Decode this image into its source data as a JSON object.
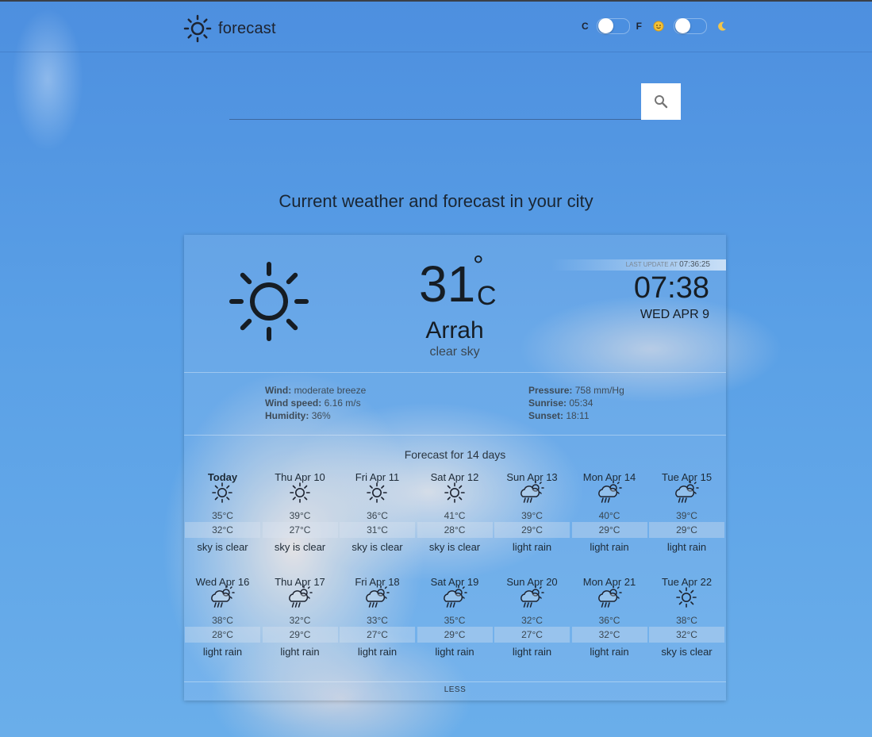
{
  "header": {
    "logo_text": "forecast",
    "unit_c": "C",
    "unit_f": "F",
    "icons": [
      "sun-logo-icon",
      "sun-face-icon",
      "moon-icon"
    ]
  },
  "search": {
    "placeholder": "",
    "icon": "search-icon"
  },
  "page_title": "Current weather and forecast in your city",
  "current": {
    "icon": "clear-sky-icon",
    "temp": "31",
    "degree_symbol": "°",
    "unit": "C",
    "city": "Arrah",
    "description": "clear sky",
    "last_update_label": "LAST UPDATE AT",
    "last_update_time": "07:36:25",
    "time": "07:38",
    "date": "WED APR 9"
  },
  "details": {
    "wind_label": "Wind:",
    "wind_value": "moderate breeze",
    "wind_speed_label": "Wind speed:",
    "wind_speed_value": "6.16 m/s",
    "humidity_label": "Humidity:",
    "humidity_value": "36%",
    "pressure_label": "Pressure:",
    "pressure_value": "758 mm/Hg",
    "sunrise_label": "Sunrise:",
    "sunrise_value": "05:34",
    "sunset_label": "Sunset:",
    "sunset_value": "18:11"
  },
  "forecast": {
    "title": "Forecast for 14 days",
    "days": [
      {
        "name": "Today",
        "icon": "sun",
        "max": "35°C",
        "min": "32°C",
        "desc": "sky is clear"
      },
      {
        "name": "Thu Apr 10",
        "icon": "sun",
        "max": "39°C",
        "min": "27°C",
        "desc": "sky is clear"
      },
      {
        "name": "Fri Apr 11",
        "icon": "sun",
        "max": "36°C",
        "min": "31°C",
        "desc": "sky is clear"
      },
      {
        "name": "Sat Apr 12",
        "icon": "sun",
        "max": "41°C",
        "min": "28°C",
        "desc": "sky is clear"
      },
      {
        "name": "Sun Apr 13",
        "icon": "rain",
        "max": "39°C",
        "min": "29°C",
        "desc": "light rain"
      },
      {
        "name": "Mon Apr 14",
        "icon": "rain",
        "max": "40°C",
        "min": "29°C",
        "desc": "light rain"
      },
      {
        "name": "Tue Apr 15",
        "icon": "rain",
        "max": "39°C",
        "min": "29°C",
        "desc": "light rain"
      },
      {
        "name": "Wed Apr 16",
        "icon": "rain",
        "max": "38°C",
        "min": "28°C",
        "desc": "light rain"
      },
      {
        "name": "Thu Apr 17",
        "icon": "rain",
        "max": "32°C",
        "min": "29°C",
        "desc": "light rain"
      },
      {
        "name": "Fri Apr 18",
        "icon": "rain",
        "max": "33°C",
        "min": "27°C",
        "desc": "light rain"
      },
      {
        "name": "Sat Apr 19",
        "icon": "rain",
        "max": "35°C",
        "min": "29°C",
        "desc": "light rain"
      },
      {
        "name": "Sun Apr 20",
        "icon": "rain",
        "max": "32°C",
        "min": "27°C",
        "desc": "light rain"
      },
      {
        "name": "Mon Apr 21",
        "icon": "rain",
        "max": "36°C",
        "min": "32°C",
        "desc": "light rain"
      },
      {
        "name": "Tue Apr 22",
        "icon": "sun",
        "max": "38°C",
        "min": "32°C",
        "desc": "sky is clear"
      }
    ],
    "less_label": "LESS"
  }
}
